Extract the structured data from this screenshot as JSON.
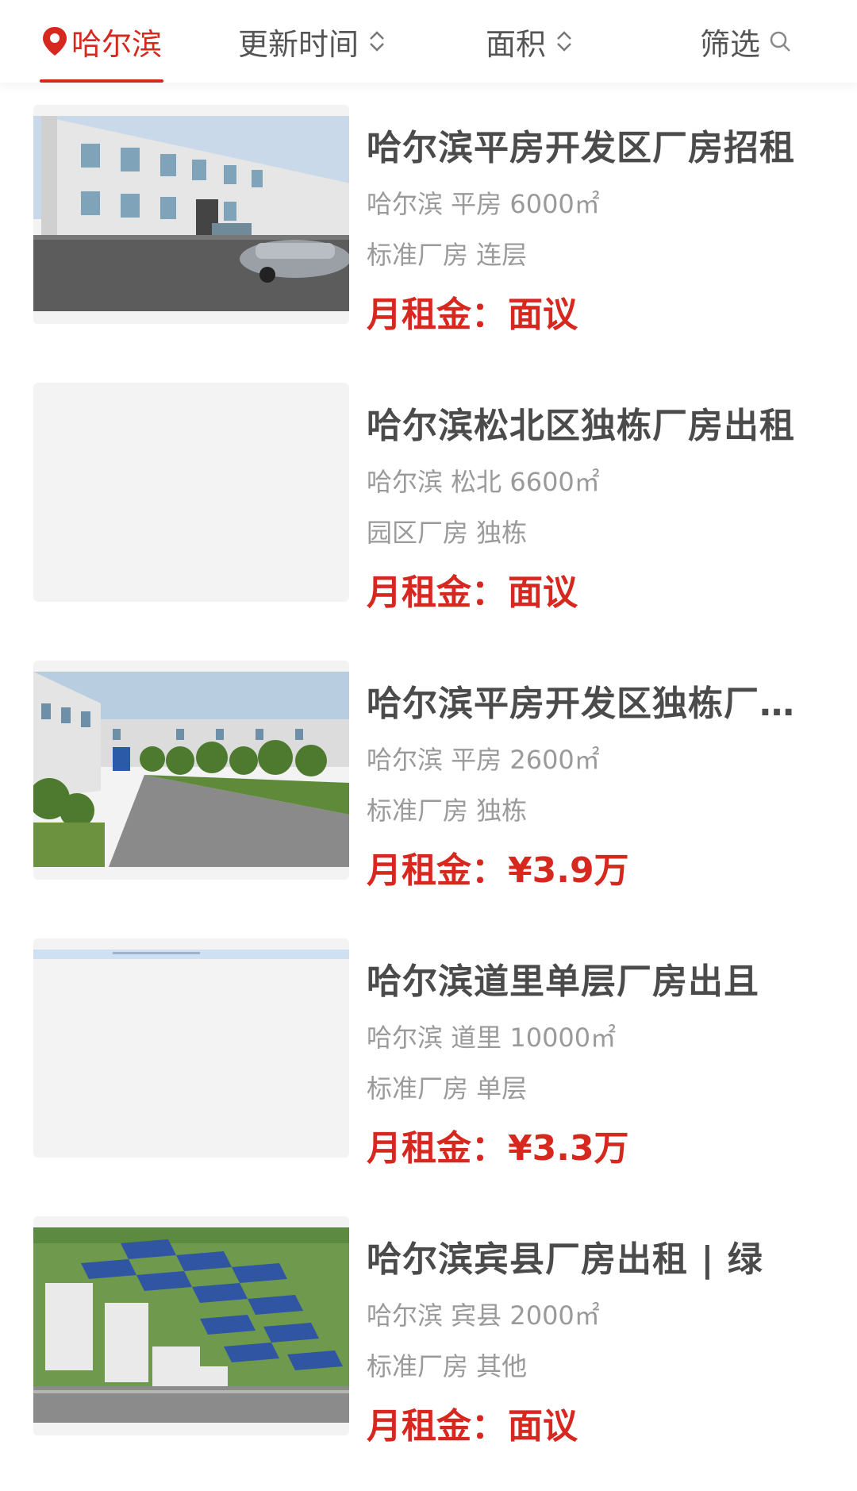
{
  "filters": {
    "city": "哈尔滨",
    "update_time": "更新时间",
    "area": "面积",
    "filter": "筛选"
  },
  "listings": [
    {
      "title": "哈尔滨平房开发区厂房招租",
      "district_info": "哈尔滨 平房 6000㎡",
      "tags": "标准厂房 连层",
      "price_label": "月租金：",
      "price": "面议",
      "image": "factory-photo"
    },
    {
      "title": "哈尔滨松北区独栋厂房出租",
      "district_info": "哈尔滨 松北 6600㎡",
      "tags": "园区厂房 独栋",
      "price_label": "月租金：",
      "price": "面议",
      "image": "placeholder"
    },
    {
      "title": "哈尔滨平房开发区独栋厂房出租",
      "district_info": "哈尔滨 平房 2600㎡",
      "tags": "标准厂房 独栋",
      "price_label": "月租金：",
      "price": "¥3.9万",
      "image": "factory-courtyard-photo"
    },
    {
      "title": "哈尔滨道里单层厂房出且",
      "district_info": "哈尔滨 道里 10000㎡",
      "tags": "标准厂房 单层",
      "price_label": "月租金：",
      "price": "¥3.3万",
      "image": "placeholder-with-sky-strip"
    },
    {
      "title": "哈尔滨宾县厂房出租 | 绿",
      "district_info": "哈尔滨 宾县 2000㎡",
      "tags": "标准厂房 其他",
      "price_label": "月租金：",
      "price": "面议",
      "image": "industrial-park-render"
    }
  ],
  "colors": {
    "accent": "#d6281f",
    "title": "#4b4b4b",
    "meta": "#9a9a9a",
    "placeholder": "#f3f3f3"
  }
}
